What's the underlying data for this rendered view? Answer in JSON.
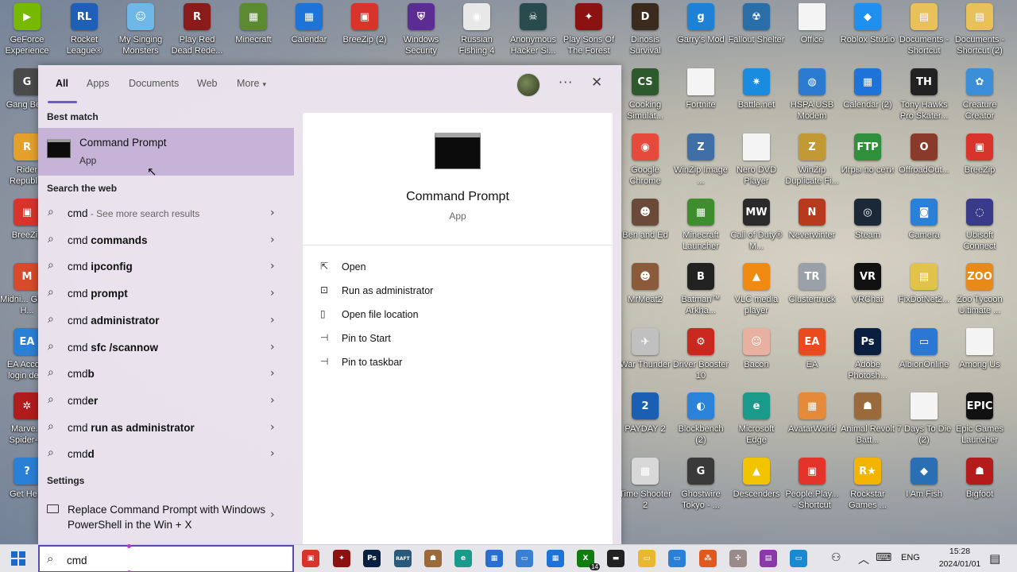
{
  "desktop": {
    "icons": [
      {
        "label": "GeForce Experience",
        "color": "#76b900",
        "glyph": "▶"
      },
      {
        "label": "Rocket League®",
        "color": "#1f5fb8",
        "glyph": "RL"
      },
      {
        "label": "My Singing Monsters",
        "color": "#6fb7e6",
        "glyph": "☺"
      },
      {
        "label": "Play Red Dead Rede...",
        "color": "#8b1a1a",
        "glyph": "R"
      },
      {
        "label": "Minecraft",
        "color": "#5c8a32",
        "glyph": "▦"
      },
      {
        "label": "Calendar",
        "color": "#1e73d8",
        "glyph": "▦"
      },
      {
        "label": "BreeZip (2)",
        "color": "#d9342b",
        "glyph": "▣"
      },
      {
        "label": "Windows Security",
        "color": "#5b2c91",
        "glyph": "⛨"
      },
      {
        "label": "Russian Fishing 4",
        "color": "#e8e8e8",
        "glyph": "◉"
      },
      {
        "label": "Anonymous Hacker Si...",
        "color": "#2a4b4e",
        "glyph": "☠"
      },
      {
        "label": "Play Sons Of The Forest",
        "color": "#8c1212",
        "glyph": "✦"
      },
      {
        "label": "Dinosis Survival",
        "color": "#3b2a1e",
        "glyph": "D"
      },
      {
        "label": "Garry's Mod",
        "color": "#1d82d6",
        "glyph": "g"
      },
      {
        "label": "Fallout Shelter",
        "color": "#2a6ea8",
        "glyph": "☢"
      },
      {
        "label": "Office",
        "color": "#f4f4f4",
        "glyph": ""
      },
      {
        "label": "Roblox Studio",
        "color": "#1f8ff0",
        "glyph": "◆"
      },
      {
        "label": "Documents - Shortcut",
        "color": "#e9c15b",
        "glyph": "▤"
      },
      {
        "label": "Documents - Shortcut (2)",
        "color": "#e9c15b",
        "glyph": "▤"
      },
      {
        "label": "Gang Be...",
        "color": "#4a4a4a",
        "glyph": "G"
      },
      {
        "label": "Cooking Simulat...",
        "color": "#2d5a2d",
        "glyph": "CS"
      },
      {
        "label": "Fortnite",
        "color": "#f4f4f4",
        "glyph": ""
      },
      {
        "label": "Battle.net",
        "color": "#1a8ce0",
        "glyph": "✷"
      },
      {
        "label": "HSPA USB Modem",
        "color": "#2b7bd0",
        "glyph": "◍"
      },
      {
        "label": "Calendar (2)",
        "color": "#1e73d8",
        "glyph": "▦"
      },
      {
        "label": "Tony Hawks Pro Skater...",
        "color": "#222222",
        "glyph": "TH"
      },
      {
        "label": "Creature Creator",
        "color": "#3a8fd8",
        "glyph": "✿"
      },
      {
        "label": "Rider Republ...",
        "color": "#e5a02c",
        "glyph": "R"
      },
      {
        "label": "Google Chrome",
        "color": "#e64a3b",
        "glyph": "◉"
      },
      {
        "label": "WinZip Image ...",
        "color": "#3f6fa6",
        "glyph": "Z"
      },
      {
        "label": "Nero DVD Player",
        "color": "#f4f4f4",
        "glyph": ""
      },
      {
        "label": "WinZip Duplicate Fi...",
        "color": "#c19a36",
        "glyph": "Z"
      },
      {
        "label": "Игры по сети",
        "color": "#2f8f3a",
        "glyph": "FTP"
      },
      {
        "label": "OffroadOut...",
        "color": "#8a3a2a",
        "glyph": "O"
      },
      {
        "label": "BreeZip",
        "color": "#d9342b",
        "glyph": "▣"
      },
      {
        "label": "BreeZip",
        "color": "#d9342b",
        "glyph": "▣"
      },
      {
        "label": "Ben and Ed",
        "color": "#6b4a3a",
        "glyph": "☻"
      },
      {
        "label": "Minecraft Launcher",
        "color": "#3e8e2e",
        "glyph": "▦"
      },
      {
        "label": "Call of Duty® M...",
        "color": "#2a2a2a",
        "glyph": "MW"
      },
      {
        "label": "Neverwinter",
        "color": "#b83a1e",
        "glyph": "N"
      },
      {
        "label": "Steam",
        "color": "#1b2838",
        "glyph": "◎"
      },
      {
        "label": "Camera",
        "color": "#2a7fd6",
        "glyph": "◙"
      },
      {
        "label": "Ubisoft Connect",
        "color": "#3a3a8a",
        "glyph": "◌"
      },
      {
        "label": "Midni... Ghost H...",
        "color": "#d84a2a",
        "glyph": "M"
      },
      {
        "label": "MrMeat2",
        "color": "#8a5a3a",
        "glyph": "☻"
      },
      {
        "label": "Batman™ Arkha...",
        "color": "#222222",
        "glyph": "B"
      },
      {
        "label": "VLC media player",
        "color": "#f08a10",
        "glyph": "▲"
      },
      {
        "label": "Clustertruck",
        "color": "#9aa0a8",
        "glyph": "TR"
      },
      {
        "label": "VRChat",
        "color": "#111111",
        "glyph": "VR"
      },
      {
        "label": "FixDotNet2...",
        "color": "#e2c34a",
        "glyph": "▤"
      },
      {
        "label": "Zoo Tycoon Ultimate ...",
        "color": "#e88a1a",
        "glyph": "ZOO"
      },
      {
        "label": "EA Acco... login de...",
        "color": "#2a7fd6",
        "glyph": "EA"
      },
      {
        "label": "War Thunder",
        "color": "#c0c0c0",
        "glyph": "✈"
      },
      {
        "label": "Driver Booster 10",
        "color": "#c8281e",
        "glyph": "⚙"
      },
      {
        "label": "Bacon",
        "color": "#e8b0a0",
        "glyph": "☺"
      },
      {
        "label": "EA",
        "color": "#ea4b1e",
        "glyph": "EA"
      },
      {
        "label": "Adobe Photosh...",
        "color": "#0a1f3f",
        "glyph": "Ps"
      },
      {
        "label": "AlbionOnline",
        "color": "#2b77d4",
        "glyph": "▭"
      },
      {
        "label": "Among Us",
        "color": "#f4f4f4",
        "glyph": ""
      },
      {
        "label": "Marve... Spider-...",
        "color": "#b01c1c",
        "glyph": "✲"
      },
      {
        "label": "PAYDAY 2",
        "color": "#1a5fb4",
        "glyph": "2"
      },
      {
        "label": "Blockbench (2)",
        "color": "#2a83d8",
        "glyph": "◐"
      },
      {
        "label": "Microsoft Edge",
        "color": "#1a9a8a",
        "glyph": "e"
      },
      {
        "label": "AvatarWorld",
        "color": "#e58a3a",
        "glyph": "▦"
      },
      {
        "label": "Animal Revolt Batt...",
        "color": "#9a6a3a",
        "glyph": "☗"
      },
      {
        "label": "7 Days To Die (2)",
        "color": "#f4f4f4",
        "glyph": ""
      },
      {
        "label": "Epic Games Launcher",
        "color": "#111111",
        "glyph": "EPIC"
      },
      {
        "label": "Get He...",
        "color": "#2a7fd6",
        "glyph": "?"
      },
      {
        "label": "Time Shooter 2",
        "color": "#d8d8d8",
        "glyph": "▦"
      },
      {
        "label": "Ghostwire Tokyo - ...",
        "color": "#3a3a3a",
        "glyph": "G"
      },
      {
        "label": "Descenders",
        "color": "#f2c400",
        "glyph": "▲"
      },
      {
        "label": "People.Play... - Shortcut",
        "color": "#e4332a",
        "glyph": "▣"
      },
      {
        "label": "Rockstar Games ...",
        "color": "#f2b400",
        "glyph": "R★"
      },
      {
        "label": "I Am Fish",
        "color": "#2a6fb4",
        "glyph": "◆"
      },
      {
        "label": "Bigfoot",
        "color": "#b41c1c",
        "glyph": "☗"
      }
    ]
  },
  "search_panel": {
    "tabs": [
      {
        "label": "All"
      },
      {
        "label": "Apps"
      },
      {
        "label": "Documents"
      },
      {
        "label": "Web"
      },
      {
        "label": "More"
      }
    ],
    "more_caret": "▾",
    "dots": "···",
    "close": "✕",
    "best_match_heading": "Best match",
    "best_match": {
      "title": "Command Prompt",
      "subtitle": "App"
    },
    "search_web_heading": "Search the web",
    "web_results": [
      {
        "prefix": "cmd",
        "bold": "",
        "hint": " - See more search results"
      },
      {
        "prefix": "cmd ",
        "bold": "commands",
        "hint": ""
      },
      {
        "prefix": "cmd ",
        "bold": "ipconfig",
        "hint": ""
      },
      {
        "prefix": "cmd ",
        "bold": "prompt",
        "hint": ""
      },
      {
        "prefix": "cmd ",
        "bold": "administrator",
        "hint": ""
      },
      {
        "prefix": "cmd ",
        "bold": "sfc /scannow",
        "hint": ""
      },
      {
        "prefix": "cmd",
        "bold": "b",
        "hint": ""
      },
      {
        "prefix": "cmd",
        "bold": "er",
        "hint": ""
      },
      {
        "prefix": "cmd ",
        "bold": "run as administrator",
        "hint": ""
      },
      {
        "prefix": "cmd",
        "bold": "d",
        "hint": ""
      }
    ],
    "settings_heading": "Settings",
    "settings_item": "Replace Command Prompt with Windows PowerShell in the Win + X",
    "detail": {
      "title": "Command Prompt",
      "subtitle": "App",
      "actions": [
        {
          "label": "Open",
          "icon": "⇱"
        },
        {
          "label": "Run as administrator",
          "icon": "⊡"
        },
        {
          "label": "Open file location",
          "icon": "▯"
        },
        {
          "label": "Pin to Start",
          "icon": "⊣"
        },
        {
          "label": "Pin to taskbar",
          "icon": "⊣"
        }
      ]
    }
  },
  "taskbar": {
    "search_value": "cmd",
    "apps": [
      {
        "name": "breezip",
        "color": "#d9342b",
        "glyph": "▣"
      },
      {
        "name": "sons-of-forest",
        "color": "#8c1212",
        "glyph": "✦"
      },
      {
        "name": "photoshop",
        "color": "#0a1f3f",
        "glyph": "Ps"
      },
      {
        "name": "raft",
        "color": "#2a5a7a",
        "glyph": "RAFT"
      },
      {
        "name": "animal-revolt",
        "color": "#9a6a3a",
        "glyph": "☗"
      },
      {
        "name": "edge",
        "color": "#1a9a8a",
        "glyph": "e"
      },
      {
        "name": "store",
        "color": "#2a6fd0",
        "glyph": "▦"
      },
      {
        "name": "window-app",
        "color": "#3a7fd0",
        "glyph": "▭"
      },
      {
        "name": "calendar",
        "color": "#1e73d8",
        "glyph": "▦"
      },
      {
        "name": "xbox",
        "color": "#107c10",
        "glyph": "X"
      },
      {
        "name": "game",
        "color": "#222222",
        "glyph": "▬"
      },
      {
        "name": "file-explorer",
        "color": "#e8b830",
        "glyph": "▭"
      },
      {
        "name": "media",
        "color": "#2a7fd6",
        "glyph": "▭"
      },
      {
        "name": "network-app",
        "color": "#e05a20",
        "glyph": "⁂"
      },
      {
        "name": "tools",
        "color": "#9a8a8a",
        "glyph": "✣"
      },
      {
        "name": "winrar",
        "color": "#8a3aa8",
        "glyph": "▤"
      },
      {
        "name": "screen",
        "color": "#1a8ad0",
        "glyph": "▭"
      }
    ],
    "xbox_badge": "14",
    "lang": "ENG",
    "time": "15:28",
    "date": "2024/01/01"
  }
}
